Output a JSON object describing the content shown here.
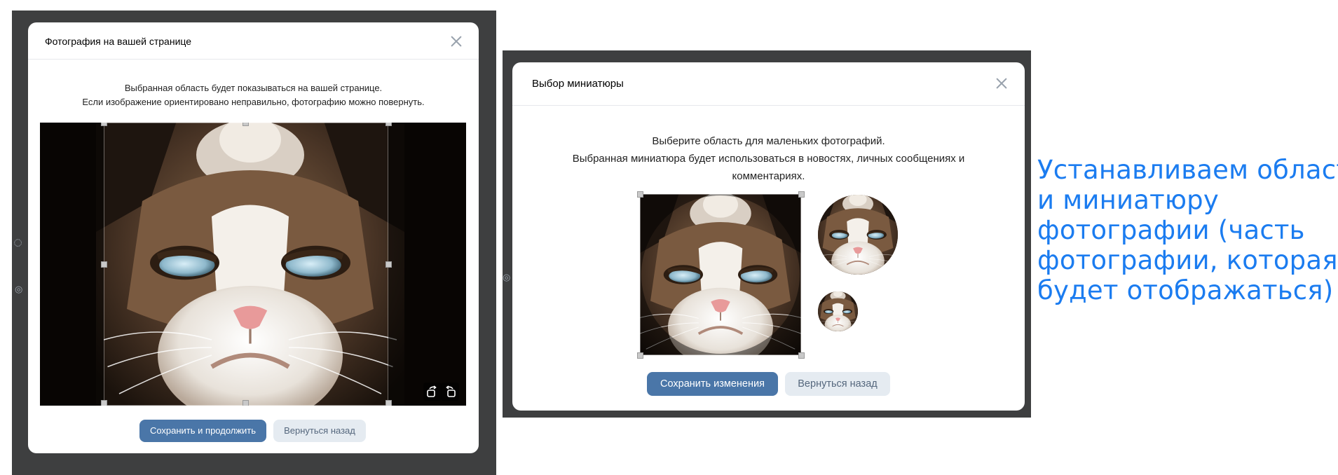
{
  "left_dialog": {
    "title": "Фотография на вашей странице",
    "description_line1": "Выбранная область будет показываться на вашей странице.",
    "description_line2": "Если изображение ориентировано неправильно, фотографию можно повернуть.",
    "primary_button": "Сохранить и продолжить",
    "secondary_button": "Вернуться назад",
    "icons": [
      "close-icon",
      "rotate-left-icon",
      "rotate-right-icon"
    ]
  },
  "right_dialog": {
    "title": "Выбор миниатюры",
    "description_line1": "Выберите область для маленьких фотографий.",
    "description_line2": "Выбранная миниатюра будет использоваться в новостях, личных сообщениях и",
    "description_line3": "комментариях.",
    "primary_button": "Сохранить изменения",
    "secondary_button": "Вернуться назад",
    "icons": [
      "close-icon"
    ]
  },
  "caption": {
    "line1": "Устанавливаем область",
    "line2": "и миниатюру",
    "line3": "фотографии (часть",
    "line4": "фотографии, которая",
    "line5": "будет отображаться)"
  },
  "colors": {
    "primary_button": "#4a76a8",
    "secondary_button": "#e5ebf1",
    "caption": "#1b7cf0",
    "backdrop": "#3e3f40"
  }
}
